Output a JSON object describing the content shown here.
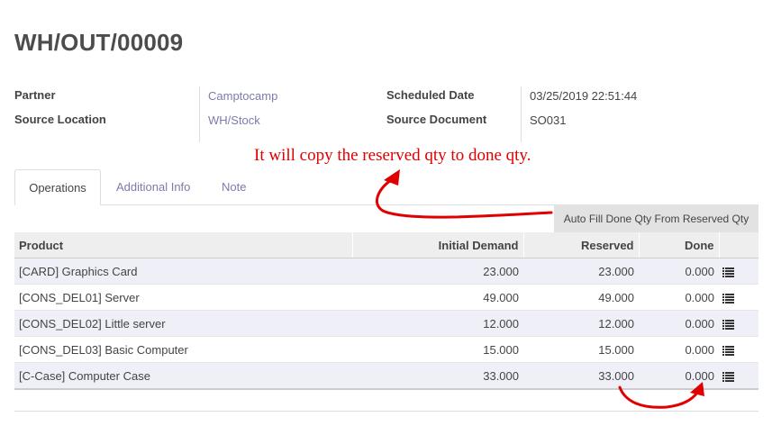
{
  "record": {
    "title": "WH/OUT/00009"
  },
  "fields": {
    "partner_label": "Partner",
    "partner_value": "Camptocamp",
    "source_location_label": "Source Location",
    "source_location_value": "WH/Stock",
    "scheduled_date_label": "Scheduled Date",
    "scheduled_date_value": "03/25/2019 22:51:44",
    "source_document_label": "Source Document",
    "source_document_value": "SO031"
  },
  "annotation": {
    "text": "It will copy the reserved qty to done qty.",
    "color": "#e00000"
  },
  "tabs": [
    {
      "label": "Operations",
      "active": true
    },
    {
      "label": "Additional Info",
      "active": false
    },
    {
      "label": "Note",
      "active": false
    }
  ],
  "auto_fill_button": {
    "label": "Auto Fill Done Qty From Reserved Qty"
  },
  "table": {
    "headers": {
      "product": "Product",
      "initial_demand": "Initial Demand",
      "reserved": "Reserved",
      "done": "Done"
    },
    "rows": [
      {
        "product": "[CARD] Graphics Card",
        "initial_demand": "23.000",
        "reserved": "23.000",
        "done": "0.000",
        "icon": "list-icon"
      },
      {
        "product": "[CONS_DEL01] Server",
        "initial_demand": "49.000",
        "reserved": "49.000",
        "done": "0.000",
        "icon": "list-icon"
      },
      {
        "product": "[CONS_DEL02] Little server",
        "initial_demand": "12.000",
        "reserved": "12.000",
        "done": "0.000",
        "icon": "list-icon"
      },
      {
        "product": "[CONS_DEL03] Basic Computer",
        "initial_demand": "15.000",
        "reserved": "15.000",
        "done": "0.000",
        "icon": "list-icon"
      },
      {
        "product": "[C-Case] Computer Case",
        "initial_demand": "33.000",
        "reserved": "33.000",
        "done": "0.000",
        "icon": "list-icon"
      }
    ]
  },
  "colors": {
    "link": "#7c7bad",
    "odd_row": "#efeff8",
    "header_bg": "#eeeeee",
    "button_bg": "#e2e2e2",
    "arrow": "#e00000"
  }
}
